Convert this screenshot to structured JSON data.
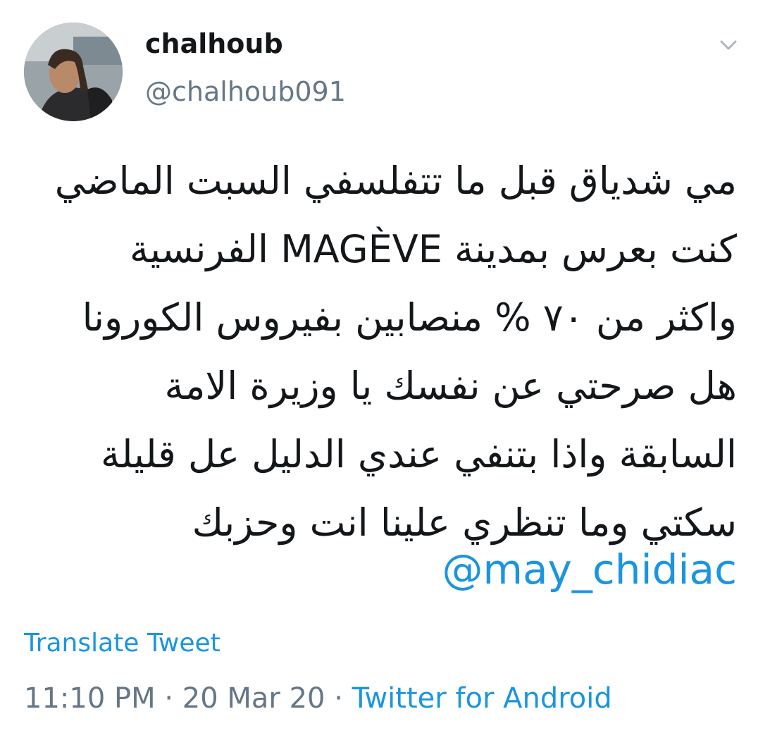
{
  "tweet": {
    "author_name": "chalhoub",
    "author_handle": "@chalhoub091",
    "text_lines": [
      "مي شدياق قبل ما تتفلسفي السبت الماضي",
      "كنت بعرس بمدينة MAGÈVE  الفرنسية",
      "واكثر من ٧٠ % منصابين بفيروس الكورونا",
      "هل صرحتي عن نفسك يا وزيرة الامة",
      "السابقة واذا بتنفي عندي الدليل عل قليلة",
      "سكتي وما تنظري علينا انت وحزبك"
    ],
    "mention": "@may_chidiac",
    "translate_label": "Translate Tweet",
    "time": "11:10 PM",
    "separator": "·",
    "date": "20 Mar 20",
    "source": "Twitter for Android"
  },
  "icons": {
    "menu": "chevron-down-icon"
  },
  "colors": {
    "link": "#1b95e0",
    "secondary_text": "#657786",
    "primary_text": "#14171a"
  }
}
